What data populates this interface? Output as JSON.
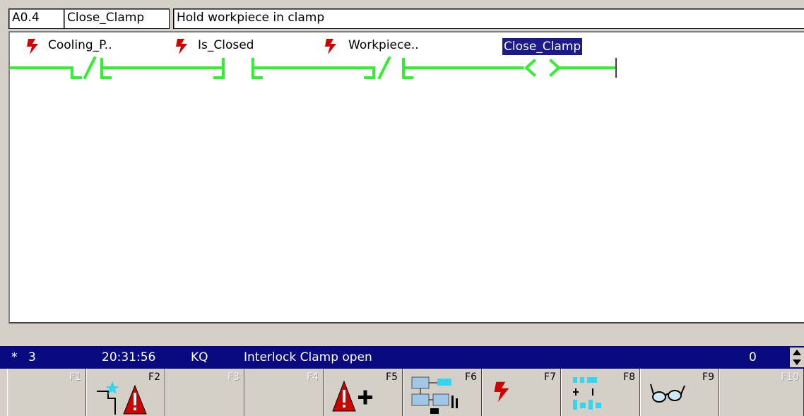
{
  "header": {
    "address": "A0.4",
    "symbol": "Close_Clamp",
    "comment": "Hold workpiece in clamp"
  },
  "ladder": {
    "operands": [
      {
        "label": "Cooling_P..",
        "type": "normally-closed"
      },
      {
        "label": "Is_Closed",
        "type": "normally-open"
      },
      {
        "label": "Workpiece..",
        "type": "normally-closed"
      }
    ],
    "coil": {
      "label": "Close_Clamp"
    },
    "colors": {
      "rung": "#33ee33",
      "bolt": "#cc0000",
      "coil_highlight": "#1b1b8c"
    }
  },
  "status": {
    "marker": "*",
    "number": "3",
    "time": "20:31:56",
    "type": "KQ",
    "message": "Interlock Clamp open",
    "count": "0",
    "bg_color": "#0a0a80"
  },
  "fkeys": [
    {
      "label": "F1",
      "enabled": false,
      "icon": "none"
    },
    {
      "label": "F2",
      "enabled": true,
      "icon": "new-alarm-icon"
    },
    {
      "label": "F3",
      "enabled": false,
      "icon": "none"
    },
    {
      "label": "F4",
      "enabled": false,
      "icon": "none"
    },
    {
      "label": "F5",
      "enabled": true,
      "icon": "add-alarm-icon"
    },
    {
      "label": "F6",
      "enabled": true,
      "icon": "network-icon"
    },
    {
      "label": "F7",
      "enabled": true,
      "icon": "lightning-icon"
    },
    {
      "label": "F8",
      "enabled": true,
      "icon": "logic-icon"
    },
    {
      "label": "F9",
      "enabled": true,
      "icon": "glasses-icon"
    },
    {
      "label": "F10",
      "enabled": false,
      "icon": "none"
    }
  ]
}
